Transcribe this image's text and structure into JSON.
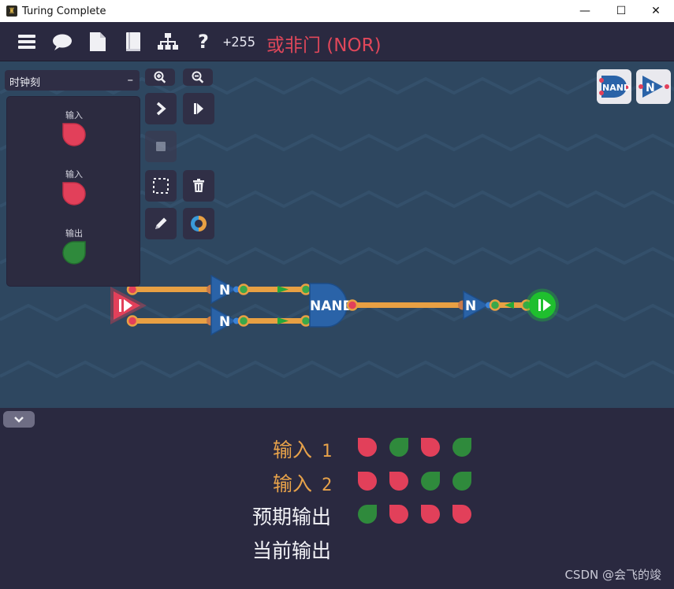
{
  "window": {
    "title": "Turing Complete",
    "minimize": "—",
    "maximize": "☐",
    "close": "✕"
  },
  "toolbar": {
    "score": "+255",
    "level_title": "或非门 (NOR)",
    "icons": [
      "menu-icon",
      "chat-icon",
      "document-icon",
      "book-icon",
      "hierarchy-icon",
      "help-icon"
    ],
    "help_glyph": "?"
  },
  "left_panel": {
    "clock_label": "时钟刻",
    "clock_toggle": "–",
    "io": [
      {
        "label": "输入",
        "color": "#e2405a"
      },
      {
        "label": "输入",
        "color": "#e2405a"
      },
      {
        "label": "输出",
        "color": "#2f8a3c"
      }
    ]
  },
  "circuit": {
    "nand_label": "NAND",
    "not_label": "N",
    "wire_color": "#e8a043",
    "input_color": "#e2405a",
    "output_color": "#1fbf2e"
  },
  "palette": {
    "nand_label": "NAND",
    "not_label": "N"
  },
  "truth_table": {
    "rows": [
      {
        "label": "输入",
        "num": "1",
        "cells": [
          "red",
          "green",
          "red",
          "green"
        ]
      },
      {
        "label": "输入",
        "num": "2",
        "cells": [
          "red",
          "red",
          "green",
          "green"
        ]
      },
      {
        "label": "预期输出",
        "num": "",
        "cells": [
          "green",
          "red",
          "red",
          "red"
        ]
      },
      {
        "label": "当前输出",
        "num": "",
        "cells": []
      }
    ],
    "colors": {
      "red": "#e2405a",
      "green": "#2f8a3c"
    }
  },
  "watermark": "CSDN @会飞的竣"
}
